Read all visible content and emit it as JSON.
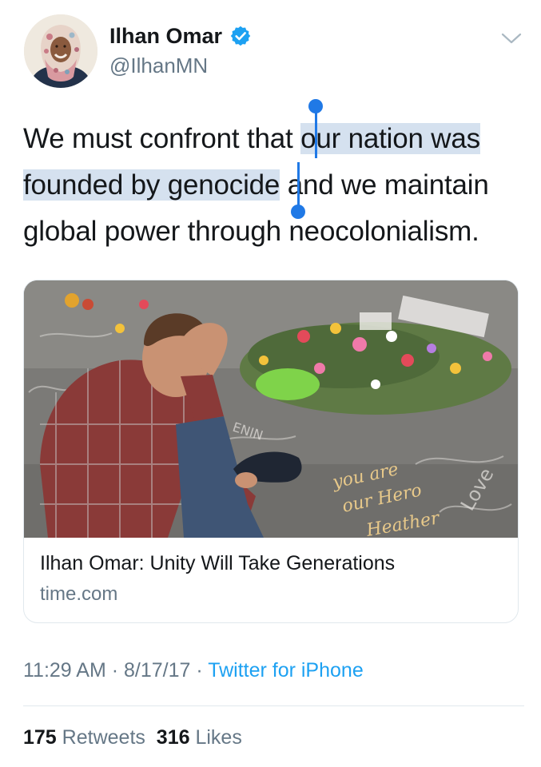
{
  "author": {
    "display_name": "Ilhan Omar",
    "handle": "@IlhanMN"
  },
  "icons": {
    "verified": "verified-badge-icon",
    "caret": "chevron-down-icon"
  },
  "tweet": {
    "text_before": "We must confront that ",
    "text_selected": "our nation was founded by genocide",
    "text_after": " and we maintain global power through neocolonialism."
  },
  "card": {
    "title": "Ilhan Omar: Unity Will Take Generations",
    "domain": "time.com",
    "image_chalk_text": [
      "you are",
      "our Hero",
      "Heather",
      "Love",
      "ENIN"
    ]
  },
  "meta": {
    "time": "11:29 AM",
    "separator": " · ",
    "date": "8/17/17",
    "source": "Twitter for iPhone"
  },
  "stats": {
    "retweets_count": "175",
    "retweets_label": "Retweets",
    "likes_count": "316",
    "likes_label": "Likes"
  },
  "colors": {
    "text": "#14171a",
    "secondary": "#657786",
    "link": "#1da1f2",
    "selection": "#d5e1ef",
    "selection_handle": "#2079e6",
    "verified": "#1da1f2",
    "divider": "#e1e8ed"
  }
}
